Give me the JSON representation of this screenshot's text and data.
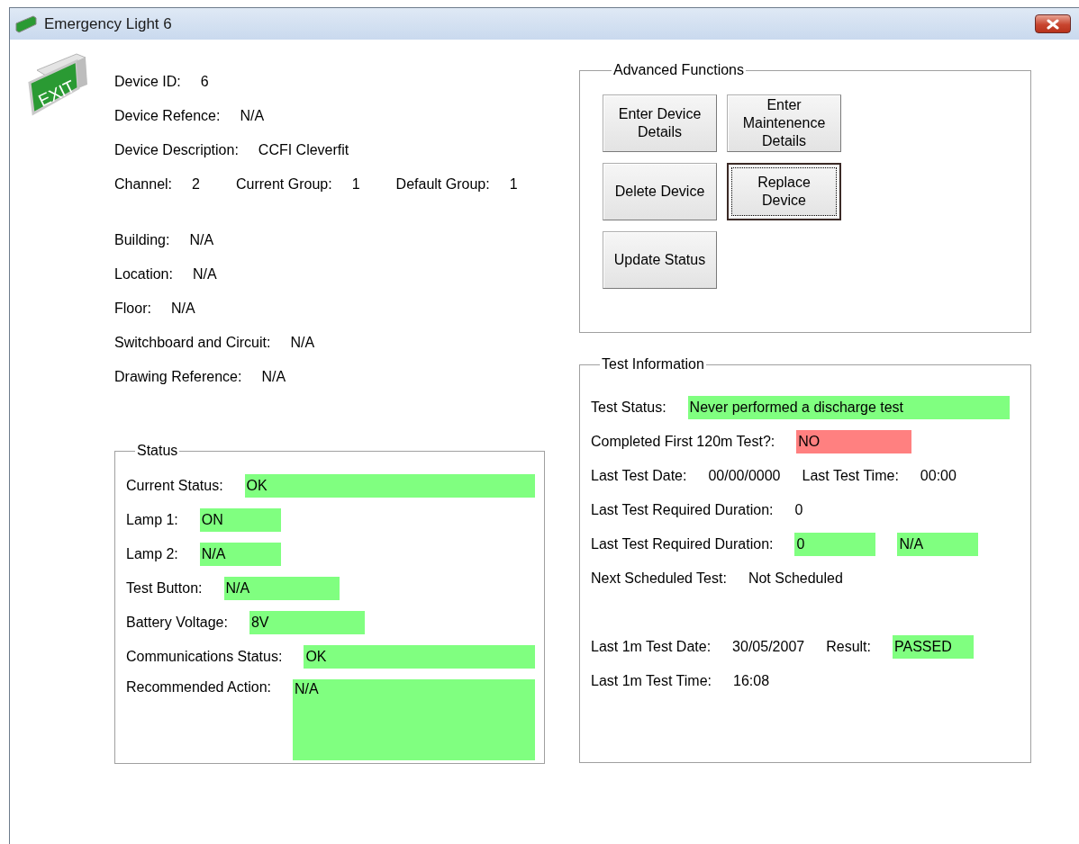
{
  "window": {
    "title": "Emergency Light 6"
  },
  "device": {
    "sign_text": "EXIT",
    "groups": [
      [
        {
          "items": [
            {
              "label": "Device ID:",
              "value": "6"
            }
          ]
        },
        {
          "items": [
            {
              "label": "Device Refence:",
              "value": "N/A"
            }
          ]
        },
        {
          "items": [
            {
              "label": "Device Description:",
              "value": "CCFI Cleverfit"
            }
          ]
        },
        {
          "items": [
            {
              "label": "Channel:",
              "value": "2"
            },
            {
              "label": "Current Group:",
              "value": "1"
            },
            {
              "label": "Default Group:",
              "value": "1"
            }
          ]
        }
      ],
      [
        {
          "items": [
            {
              "label": "Building:",
              "value": "N/A"
            }
          ]
        },
        {
          "items": [
            {
              "label": "Location:",
              "value": "N/A"
            }
          ]
        },
        {
          "items": [
            {
              "label": "Floor:",
              "value": "N/A"
            }
          ]
        },
        {
          "items": [
            {
              "label": "Switchboard and Circuit:",
              "value": "N/A"
            }
          ]
        },
        {
          "items": [
            {
              "label": "Drawing Reference:",
              "value": "N/A"
            }
          ]
        }
      ]
    ]
  },
  "status": {
    "title": "Status",
    "rows": [
      {
        "label": "Current Status:",
        "value": "OK",
        "color": "#80ff80"
      },
      {
        "label": "Lamp 1:",
        "value": "ON",
        "color": "#80ff80"
      },
      {
        "label": "Lamp 2:",
        "value": "N/A",
        "color": "#80ff80"
      },
      {
        "label": "Test Button:",
        "value": "N/A",
        "color": "#80ff80"
      },
      {
        "label": "Battery Voltage:",
        "value": "8V",
        "color": "#80ff80"
      },
      {
        "label": "Communications Status:",
        "value": "OK",
        "color": "#80ff80"
      },
      {
        "label": "Recommended Action:",
        "value": "N/A",
        "color": "#80ff80"
      }
    ]
  },
  "advanced": {
    "title": "Advanced Functions",
    "buttons": [
      {
        "label": "Enter Device Details",
        "focused": false
      },
      {
        "label": "Enter Maintenence Details",
        "focused": false
      },
      {
        "label": "Delete Device",
        "focused": false
      },
      {
        "label": "Replace Device",
        "focused": true
      },
      {
        "label": "Update Status",
        "focused": false
      }
    ]
  },
  "test": {
    "title": "Test Information",
    "groups": [
      [
        {
          "items": [
            {
              "kind": "text",
              "text": "Test Status:"
            },
            {
              "kind": "field",
              "text": "Never performed a discharge test",
              "color": "#80ff80"
            }
          ]
        },
        {
          "items": [
            {
              "kind": "text",
              "text": "Completed First 120m Test?:"
            },
            {
              "kind": "field",
              "text": "NO",
              "color": "#ff8080"
            }
          ]
        },
        {
          "items": [
            {
              "kind": "text",
              "text": "Last Test Date:"
            },
            {
              "kind": "text",
              "text": "00/00/0000"
            },
            {
              "kind": "text",
              "text": "Last Test Time:"
            },
            {
              "kind": "text",
              "text": "00:00"
            }
          ]
        },
        {
          "items": [
            {
              "kind": "text",
              "text": "Last Test Required Duration:"
            },
            {
              "kind": "text",
              "text": "0"
            }
          ]
        },
        {
          "items": [
            {
              "kind": "text",
              "text": "Last Test Required Duration:"
            },
            {
              "kind": "field",
              "text": "0",
              "color": "#80ff80"
            },
            {
              "kind": "field",
              "text": "N/A",
              "color": "#80ff80"
            }
          ]
        },
        {
          "items": [
            {
              "kind": "text",
              "text": "Next Scheduled Test:"
            },
            {
              "kind": "text",
              "text": "Not Scheduled"
            }
          ]
        }
      ],
      [
        {
          "items": [
            {
              "kind": "text",
              "text": "Last 1m Test Date:"
            },
            {
              "kind": "text",
              "text": "30/05/2007"
            },
            {
              "kind": "text",
              "text": "Result:"
            },
            {
              "kind": "field",
              "text": "PASSED",
              "color": "#80ff80"
            }
          ]
        },
        {
          "items": [
            {
              "kind": "text",
              "text": "Last 1m Test Time:"
            },
            {
              "kind": "text",
              "text": "16:08"
            }
          ]
        }
      ]
    ]
  }
}
